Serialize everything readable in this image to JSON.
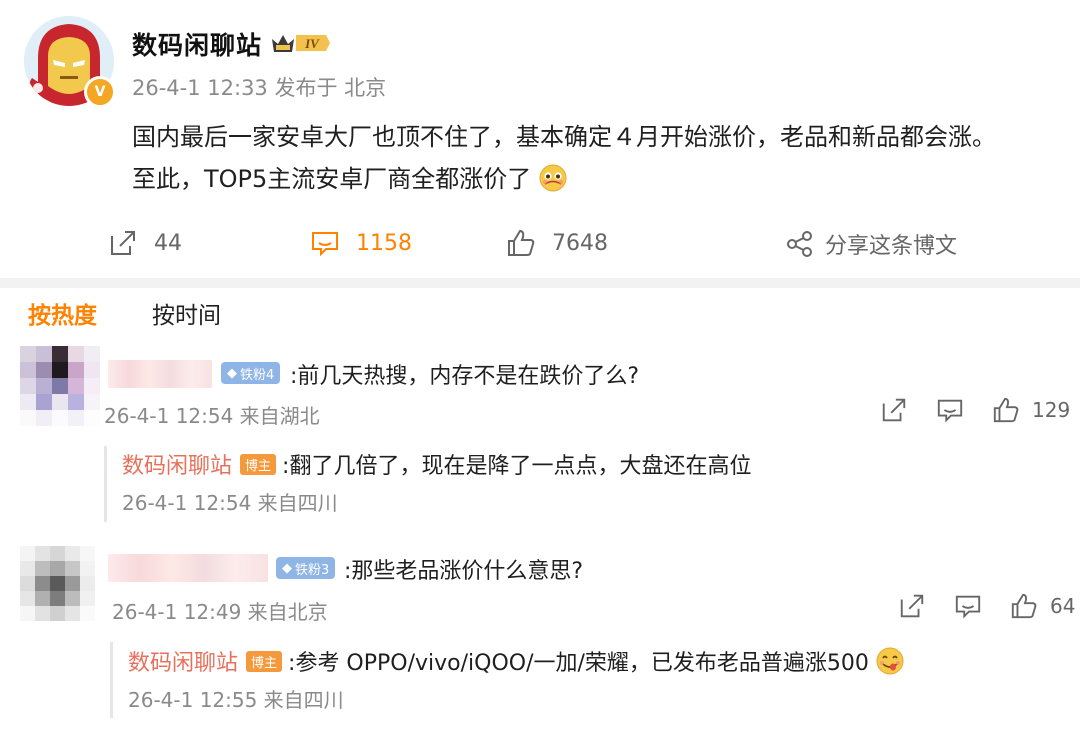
{
  "post": {
    "username": "数码闲聊站",
    "level_badge": "IV",
    "verified_mark": "V",
    "meta": "26-4-1 12:33 发布于 北京",
    "text_line1": "国内最后一家安卓大厂也顶不住了，基本确定４月开始涨价，老品和新品都会涨。",
    "text_line2": "至此，TOP5主流安卓厂商全都涨价了",
    "emoji": "pleading-face",
    "actions": {
      "repost": "44",
      "comments": "1158",
      "likes": "7648",
      "share": "分享这条博文"
    }
  },
  "tabs": {
    "hot": "按热度",
    "time": "按时间",
    "active": "hot"
  },
  "comments": [
    {
      "fan_badge": "铁粉4",
      "text": ":前几天热搜，内存不是在跌价了么?",
      "meta": "26-4-1 12:54 来自湖北",
      "likes": "129",
      "reply": {
        "name": "数码闲聊站",
        "badge": "博主",
        "text": ":翻了几倍了，现在是降了一点点，大盘还在高位",
        "meta": "26-4-1 12:54 来自四川"
      }
    },
    {
      "fan_badge": "铁粉3",
      "text": ":那些老品涨价什么意思?",
      "meta": "26-4-1 12:49 来自北京",
      "likes": "64",
      "reply": {
        "name": "数码闲聊站",
        "badge": "博主",
        "text": ":参考 OPPO/vivo/iQOO/一加/荣耀，已发布老品普遍涨500",
        "meta": "26-4-1 12:55 来自四川",
        "emoji": "yum-face"
      }
    }
  ],
  "colors": {
    "accent": "#ff8200",
    "reply_name": "#e8705a",
    "fan_badge": "#8fb4e6",
    "host_badge": "#f59a3c"
  }
}
